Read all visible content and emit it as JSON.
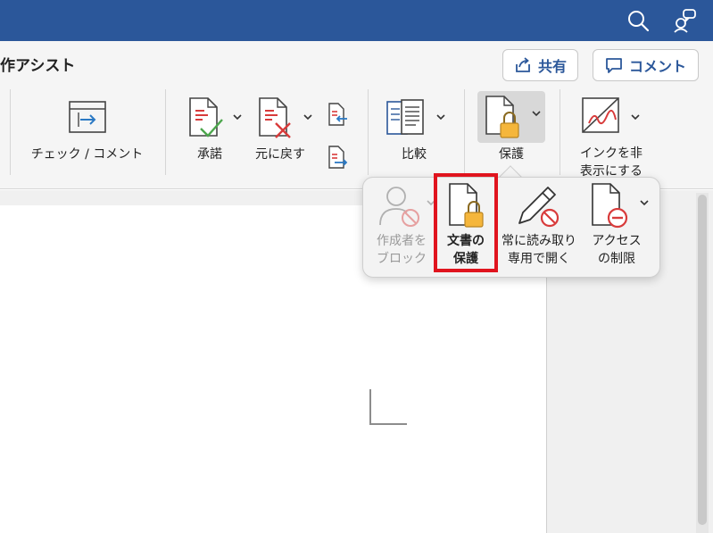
{
  "ribbon": {
    "title": "作アシスト",
    "share_label": "共有",
    "comment_label": "コメント",
    "buttons": {
      "check_comment": "チェック / コメント",
      "accept": "承諾",
      "revert": "元に戻す",
      "compare": "比較",
      "protect": "保護",
      "hide_ink_line1": "インクを非",
      "hide_ink_line2": "表示にする"
    }
  },
  "protect_menu": {
    "items": [
      {
        "line1": "作成者を",
        "line2": "ブロック",
        "enabled": false
      },
      {
        "line1": "文書の",
        "line2": "保護",
        "enabled": true,
        "highlighted": true
      },
      {
        "line1": "常に読み取り",
        "line2": "専用で開く",
        "enabled": true
      },
      {
        "line1": "アクセス",
        "line2": "の制限",
        "enabled": true
      }
    ]
  },
  "colors": {
    "titlebar": "#2b579a",
    "accent": "#2b579a",
    "highlight": "#e0141e",
    "lock": "#f5b63b",
    "check_green": "#4ca64c",
    "reject_red": "#d83b3b"
  },
  "icons": [
    "search-icon",
    "feedback-icon",
    "share-icon",
    "comment-icon",
    "check-comment-icon",
    "accept-icon",
    "revert-icon",
    "previous-change-icon",
    "next-change-icon",
    "compare-icon",
    "protect-icon",
    "hide-ink-icon",
    "block-authors-icon",
    "protect-document-icon",
    "always-read-only-icon",
    "restrict-access-icon"
  ]
}
